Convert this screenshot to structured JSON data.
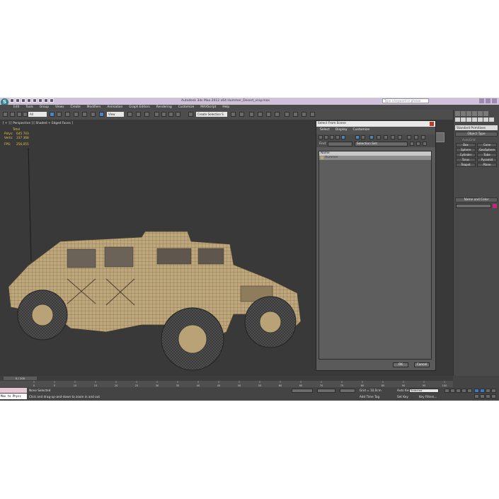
{
  "window": {
    "title": "Autodesk 3ds Max 2012 x64    Hummer_Desert_vray.max",
    "search_placeholder": "Type a keyword or phrase",
    "logo": "S"
  },
  "menu": [
    "Edit",
    "Tools",
    "Group",
    "Views",
    "Create",
    "Modifiers",
    "Animation",
    "Graph Editors",
    "Rendering",
    "Customize",
    "MAXScript",
    "Help"
  ],
  "toolbar": {
    "selection_filter": "All",
    "ref_coord": "View",
    "named_selection": "Create Selection S"
  },
  "viewport": {
    "label": "[ + ] [ Perspective ] [ Shaded + Edged Faces ]",
    "stats": {
      "header": "Total",
      "polys_label": "Polys:",
      "polys_value": "645 743",
      "verts_label": "Verts:",
      "verts_value": "337 368",
      "fps_label": "FPS:",
      "fps_value": "256,055"
    }
  },
  "dialog": {
    "title": "Select From Scene",
    "menu": [
      "Select",
      "Display",
      "Customize"
    ],
    "find_label": "Find:",
    "selection_set_label": "Selection Set:",
    "column_header": "Name",
    "objects": [
      "Hummer"
    ],
    "ok": "OK",
    "cancel": "Cancel"
  },
  "command_panel": {
    "category": "Standard Primitives",
    "object_type_title": "Object Type",
    "autogrid": "AutoGrid",
    "buttons": [
      "Box",
      "Cone",
      "Sphere",
      "GeoSphere",
      "Cylinder",
      "Tube",
      "Torus",
      "Pyramid",
      "Teapot",
      "Plane"
    ],
    "name_color_title": "Name and Color",
    "color": "#c02a7e"
  },
  "timeline": {
    "slider": "0 / 100",
    "ticks": [
      "0",
      "5",
      "10",
      "15",
      "20",
      "25",
      "30",
      "35",
      "40",
      "45",
      "50",
      "55",
      "60",
      "65",
      "70",
      "75",
      "80",
      "85",
      "90",
      "95",
      "100"
    ]
  },
  "status": {
    "maxscript": "Max to Physc",
    "selection": "None Selected",
    "prompt": "Click and drag-up-and-down to zoom in and out",
    "grid": "Grid = 10,0cm",
    "add_time_tag": "Add Time Tag",
    "auto_key": "Auto Key",
    "set_key": "Set Key",
    "selected": "Selected",
    "key_filters": "Key Filters..."
  }
}
